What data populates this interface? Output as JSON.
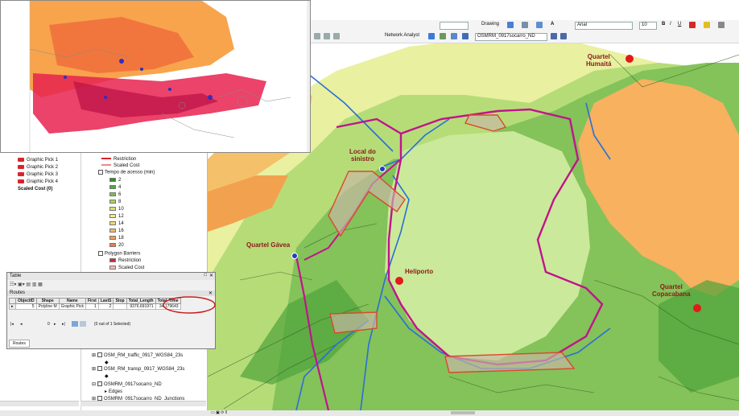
{
  "toolbar": {
    "drawing_label": "Drawing",
    "font_name": "Arial",
    "font_size": "10",
    "bold": "B",
    "italic": "I",
    "underline": "U",
    "network_analyst_label": "Network Analyst",
    "network_dataset": "OSMRM_0917socarro_ND"
  },
  "toc": {
    "graphic_picks": [
      "Graphic Pick 1",
      "Graphic Pick 2",
      "Graphic Pick 3",
      "Graphic Pick 4"
    ],
    "scaled_cost": "Scaled Cost (0)",
    "restriction": "Restriction",
    "scaled_cost_item": "Scaled Cost",
    "tempo_group": "Tempo de acesso (min)",
    "tempo_classes": [
      {
        "label": "2",
        "color": "#2e8b2e"
      },
      {
        "label": "4",
        "color": "#55a63a"
      },
      {
        "label": "6",
        "color": "#7cc04a"
      },
      {
        "label": "8",
        "color": "#a6d35a"
      },
      {
        "label": "10",
        "color": "#d4e46c"
      },
      {
        "label": "12",
        "color": "#f0ee7a"
      },
      {
        "label": "14",
        "color": "#f6d27a"
      },
      {
        "label": "16",
        "color": "#f7b46a"
      },
      {
        "label": "18",
        "color": "#f49a5a"
      },
      {
        "label": "20",
        "color": "#f07a4a"
      }
    ],
    "polygon_barriers": "Polygon Barriers",
    "pb_restriction": "Restriction",
    "pb_scaled_cost": "Scaled Cost",
    "layers": [
      "OSM_RM_traffic_0917_WGS84_23s",
      "OSM_RM_transp_0917_WGS84_23s",
      "OSMRM_0917socarro_ND",
      "Edges",
      "OSMRM_0917socarro_ND_Junctions"
    ]
  },
  "table": {
    "window_title": "Table",
    "sub_title": "Routes",
    "columns": [
      "ObjectID",
      "Shape",
      "Name",
      "FirstStopID",
      "LastStopID",
      "StopCount",
      "Total_Length",
      "Total_Time"
    ],
    "col_labels": [
      "ObjectID",
      "Shape",
      "Name",
      "First",
      "LastS",
      "Stop",
      "Total_Length",
      "Total_Time"
    ],
    "rows": [
      [
        "5",
        "Polyline M",
        "Graphic Pick",
        "1",
        "2",
        "",
        "9376.691971",
        "34.179643"
      ]
    ],
    "record": "0",
    "selection_text": "(0 out of 1 Selected)",
    "tab_label": "Routes"
  },
  "map": {
    "labels": {
      "quartel_humaita": "Quartel\nHumaitá",
      "local_sinistro": "Local do\nsinistro",
      "quartel_gavea": "Quartel Gávea",
      "heliporto": "Heliporto",
      "quartel_copacabana": "Quartel\nCopacabana"
    },
    "colors": {
      "route": "#c0148c",
      "river": "#2a6fd6",
      "barrier": "#d94a2a",
      "station": "#e21a1a"
    }
  }
}
